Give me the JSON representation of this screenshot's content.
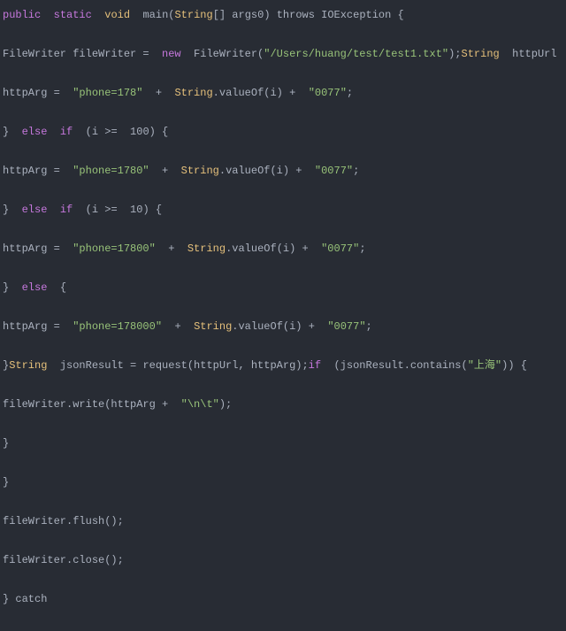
{
  "colors": {
    "background": "#282c34",
    "keyword": "#c678dd",
    "type": "#e5c07b",
    "string": "#98c379",
    "plain": "#abb2bf"
  },
  "lines": [
    [
      [
        "public",
        "kw"
      ],
      [
        "  ",
        "pl"
      ],
      [
        "static",
        "kw"
      ],
      [
        "  ",
        "pl"
      ],
      [
        "void",
        "ty"
      ],
      [
        "  main(",
        "pl"
      ],
      [
        "String",
        "ty"
      ],
      [
        "[] args0) throws IOException {",
        "pl"
      ]
    ],
    [
      [
        "FileWriter fileWriter =  ",
        "pl"
      ],
      [
        "new",
        "kw"
      ],
      [
        "  FileWriter(",
        "pl"
      ],
      [
        "\"/Users/huang/test/test1.txt\"",
        "st"
      ],
      [
        ");",
        "pl"
      ],
      [
        "String",
        "ty"
      ],
      [
        "  httpUrl",
        "pl"
      ]
    ],
    [
      [
        "httpArg =  ",
        "pl"
      ],
      [
        "\"phone=178\"",
        "st"
      ],
      [
        "  +  ",
        "pl"
      ],
      [
        "String",
        "ty"
      ],
      [
        ".valueOf(i) +  ",
        "pl"
      ],
      [
        "\"0077\"",
        "st"
      ],
      [
        ";",
        "pl"
      ]
    ],
    [
      [
        "}  ",
        "pl"
      ],
      [
        "else",
        "kw"
      ],
      [
        "  ",
        "pl"
      ],
      [
        "if",
        "kw"
      ],
      [
        "  (i >=  100) {",
        "pl"
      ]
    ],
    [
      [
        "httpArg =  ",
        "pl"
      ],
      [
        "\"phone=1780\"",
        "st"
      ],
      [
        "  +  ",
        "pl"
      ],
      [
        "String",
        "ty"
      ],
      [
        ".valueOf(i) +  ",
        "pl"
      ],
      [
        "\"0077\"",
        "st"
      ],
      [
        ";",
        "pl"
      ]
    ],
    [
      [
        "}  ",
        "pl"
      ],
      [
        "else",
        "kw"
      ],
      [
        "  ",
        "pl"
      ],
      [
        "if",
        "kw"
      ],
      [
        "  (i >=  10) {",
        "pl"
      ]
    ],
    [
      [
        "httpArg =  ",
        "pl"
      ],
      [
        "\"phone=17800\"",
        "st"
      ],
      [
        "  +  ",
        "pl"
      ],
      [
        "String",
        "ty"
      ],
      [
        ".valueOf(i) +  ",
        "pl"
      ],
      [
        "\"0077\"",
        "st"
      ],
      [
        ";",
        "pl"
      ]
    ],
    [
      [
        "}  ",
        "pl"
      ],
      [
        "else",
        "kw"
      ],
      [
        "  {",
        "pl"
      ]
    ],
    [
      [
        "httpArg =  ",
        "pl"
      ],
      [
        "\"phone=178000\"",
        "st"
      ],
      [
        "  +  ",
        "pl"
      ],
      [
        "String",
        "ty"
      ],
      [
        ".valueOf(i) +  ",
        "pl"
      ],
      [
        "\"0077\"",
        "st"
      ],
      [
        ";",
        "pl"
      ]
    ],
    [
      [
        "}",
        "pl"
      ],
      [
        "String",
        "ty"
      ],
      [
        "  jsonResult = request(httpUrl, httpArg);",
        "pl"
      ],
      [
        "if",
        "kw"
      ],
      [
        "  (jsonResult.contains(",
        "pl"
      ],
      [
        "\"上海\"",
        "st"
      ],
      [
        ")) {",
        "pl"
      ]
    ],
    [
      [
        "fileWriter.write(httpArg +  ",
        "pl"
      ],
      [
        "\"\\n\\t\"",
        "st"
      ],
      [
        ");",
        "pl"
      ]
    ],
    [
      [
        "}",
        "pl"
      ]
    ],
    [
      [
        "}",
        "pl"
      ]
    ],
    [
      [
        "fileWriter.flush();",
        "pl"
      ]
    ],
    [
      [
        "fileWriter.close();",
        "pl"
      ]
    ],
    [
      [
        "} catch",
        "pl"
      ]
    ]
  ]
}
